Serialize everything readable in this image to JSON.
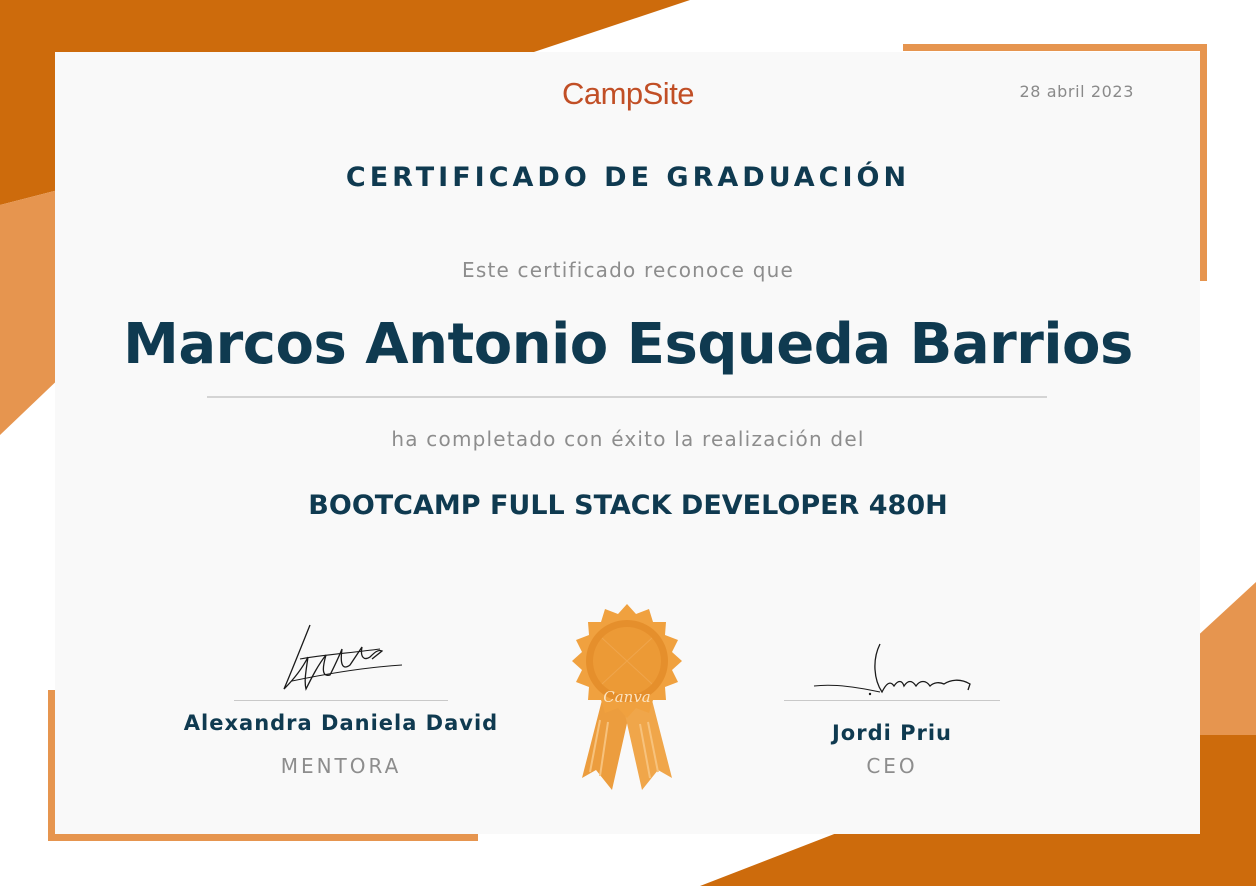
{
  "header": {
    "logo": "CampSite",
    "date": "28 abril 2023"
  },
  "certificate": {
    "title": "CERTIFICADO DE GRADUACIÓN",
    "intro": "Este certificado reconoce que",
    "recipient": "Marcos Antonio Esqueda Barrios",
    "completed_text": "ha completado con éxito la realización del",
    "course": "BOOTCAMP FULL STACK DEVELOPER 480H"
  },
  "signatories": [
    {
      "name": "Alexandra Daniela David",
      "role": "MENTORA"
    },
    {
      "name": "Jordi Priu",
      "role": "CEO"
    }
  ],
  "badge": {
    "text": "Canva"
  },
  "colors": {
    "primary_orange": "#cd6b0c",
    "light_orange": "#e6954f",
    "navy": "#0f3a50",
    "logo_red": "#c14f26",
    "muted_gray": "#8d8d8d"
  }
}
